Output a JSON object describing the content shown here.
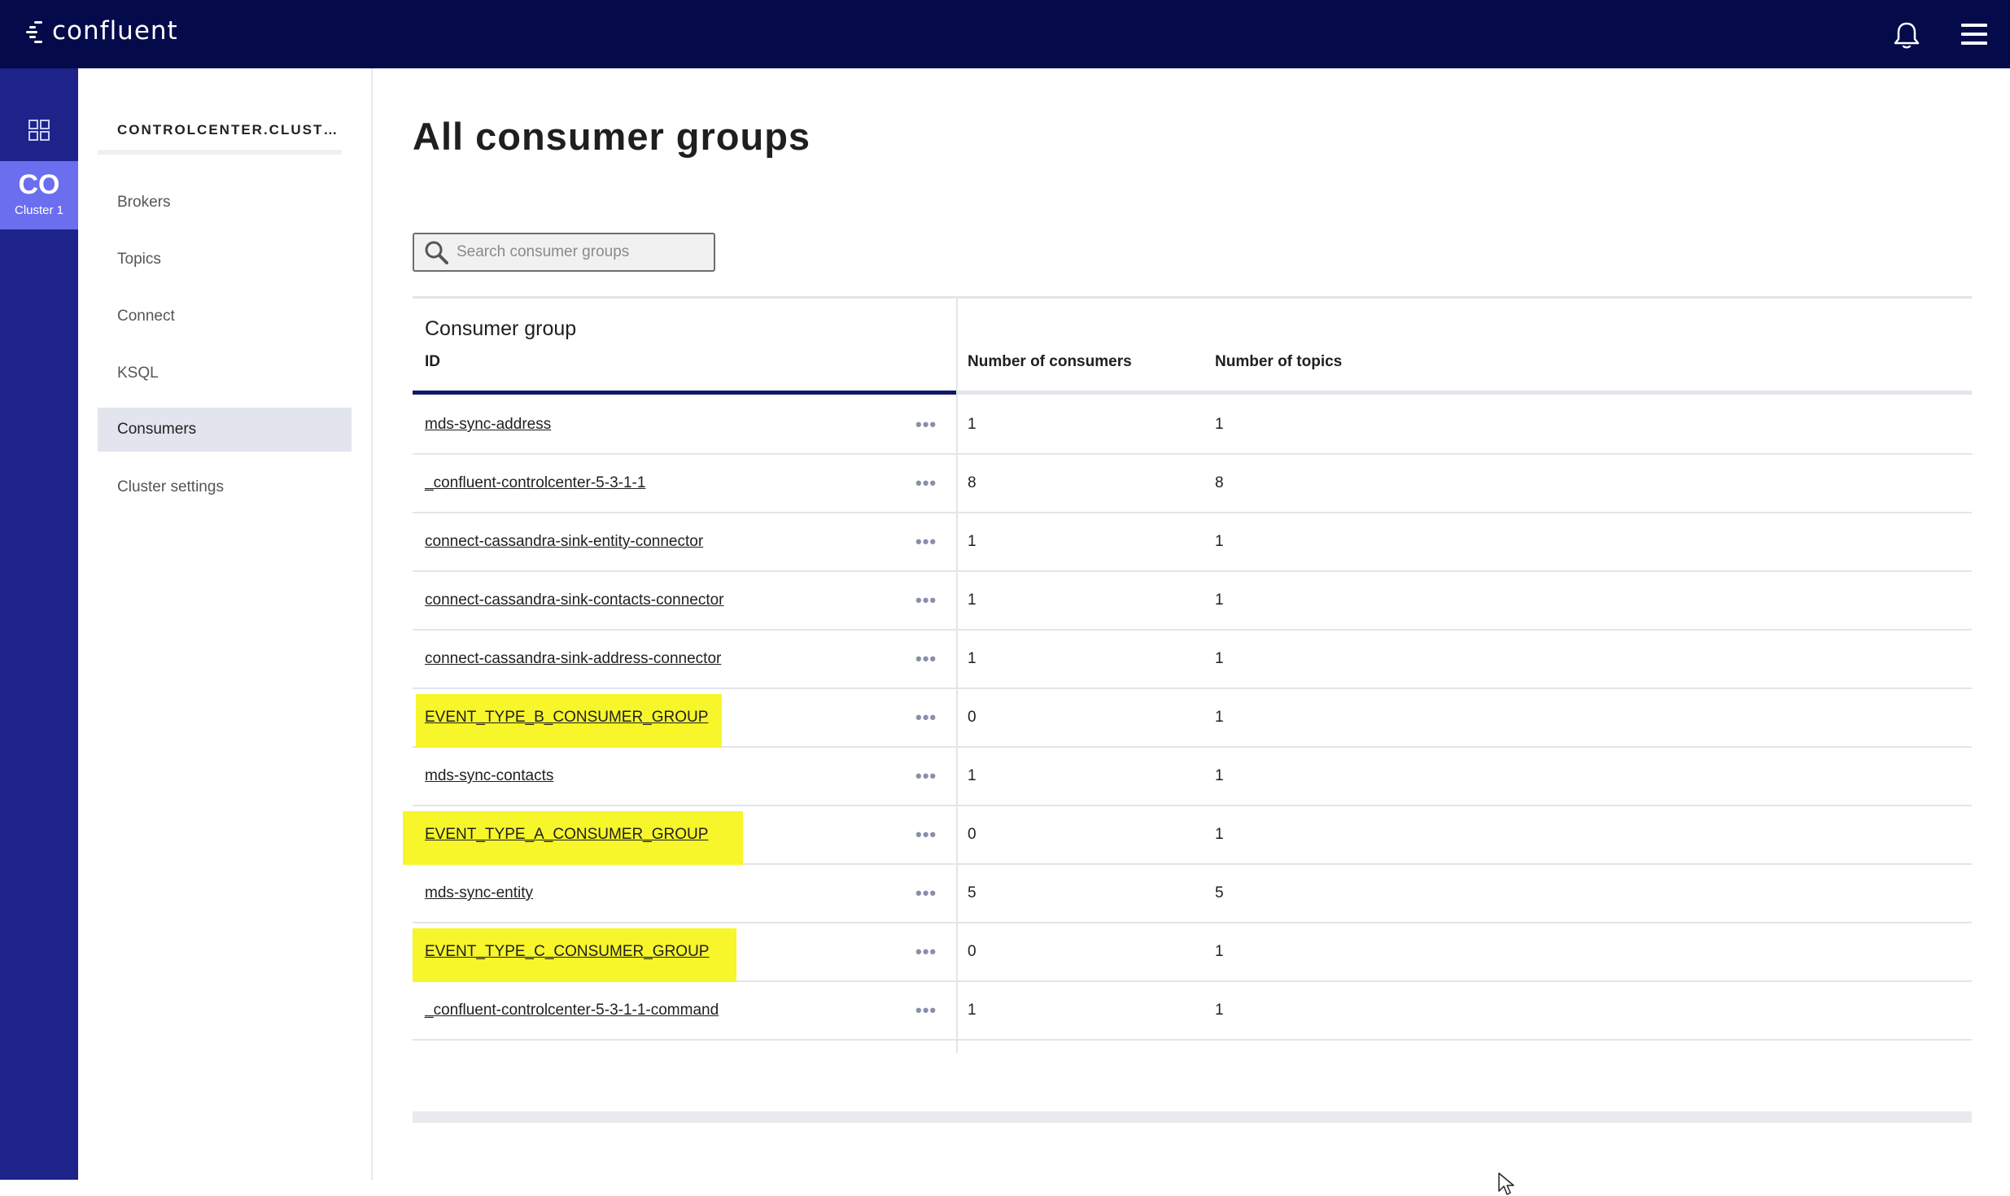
{
  "brand": {
    "logo_text": "confluent"
  },
  "topbar": {
    "icons": [
      "bell-icon",
      "hamburger-menu-icon"
    ]
  },
  "rail": {
    "cluster_abbr": "CO",
    "cluster_name": "Cluster 1"
  },
  "subnav": {
    "title": "CONTROLCENTER.CLUST…",
    "items": [
      {
        "label": "Brokers",
        "active": false
      },
      {
        "label": "Topics",
        "active": false
      },
      {
        "label": "Connect",
        "active": false
      },
      {
        "label": "KSQL",
        "active": false
      },
      {
        "label": "Consumers",
        "active": true
      },
      {
        "label": "Cluster settings",
        "active": false
      }
    ]
  },
  "page": {
    "title": "All consumer groups"
  },
  "search": {
    "placeholder": "Search consumer groups",
    "value": ""
  },
  "table": {
    "header_group": "Consumer group",
    "header_id": "ID",
    "header_consumers": "Number of consumers",
    "header_topics": "Number of topics",
    "highlight_color": "#f6f62b",
    "rows": [
      {
        "id": "mds-sync-address",
        "consumers": "1",
        "topics": "1",
        "highlighted": false
      },
      {
        "id": "_confluent-controlcenter-5-3-1-1",
        "consumers": "8",
        "topics": "8",
        "highlighted": false
      },
      {
        "id": "connect-cassandra-sink-entity-connector",
        "consumers": "1",
        "topics": "1",
        "highlighted": false
      },
      {
        "id": "connect-cassandra-sink-contacts-connector",
        "consumers": "1",
        "topics": "1",
        "highlighted": false
      },
      {
        "id": "connect-cassandra-sink-address-connector",
        "consumers": "1",
        "topics": "1",
        "highlighted": false
      },
      {
        "id": "EVENT_TYPE_B_CONSUMER_GROUP",
        "consumers": "0",
        "topics": "1",
        "highlighted": true
      },
      {
        "id": "mds-sync-contacts",
        "consumers": "1",
        "topics": "1",
        "highlighted": false
      },
      {
        "id": "EVENT_TYPE_A_CONSUMER_GROUP",
        "consumers": "0",
        "topics": "1",
        "highlighted": true
      },
      {
        "id": "mds-sync-entity",
        "consumers": "5",
        "topics": "5",
        "highlighted": false
      },
      {
        "id": "EVENT_TYPE_C_CONSUMER_GROUP",
        "consumers": "0",
        "topics": "1",
        "highlighted": true
      },
      {
        "id": "_confluent-controlcenter-5-3-1-1-command",
        "consumers": "1",
        "topics": "1",
        "highlighted": false
      }
    ],
    "row_menu_glyph": "•••"
  },
  "colors": {
    "topbar": "#040a4a",
    "rail": "#1d2389",
    "cluster_tile": "#6b6eef",
    "active_nav": "#e3e5ee",
    "header_accent": "#0f1a6b"
  }
}
